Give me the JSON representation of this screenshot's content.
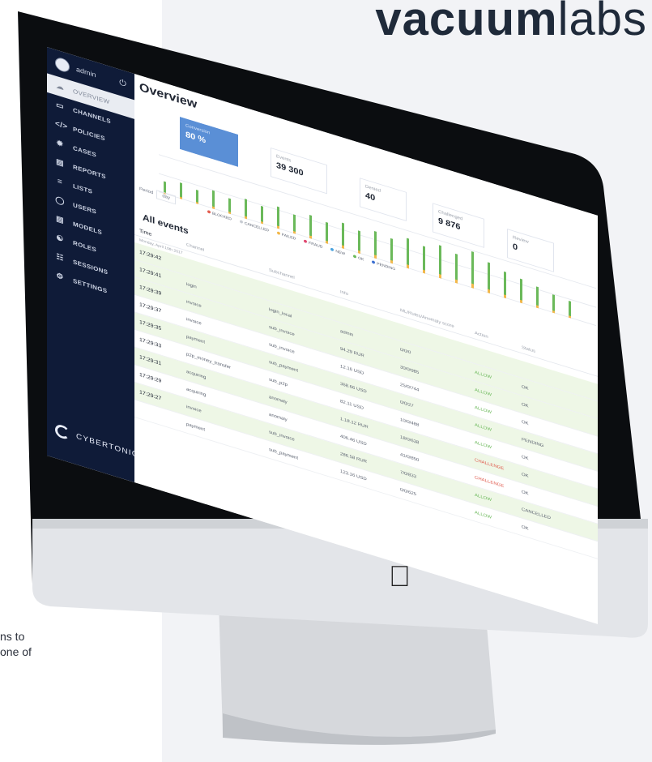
{
  "brand": {
    "name_bold": "vacuum",
    "name_light": "labs",
    "accent": "#e4115d",
    "text_color": "#1f2a3a"
  },
  "caption_fragment": [
    "ns to",
    "one of"
  ],
  "app": {
    "sidebar": {
      "user": "admin",
      "items": [
        {
          "label": "OVERVIEW",
          "icon": "cloud-icon",
          "active": true
        },
        {
          "label": "CHANNELS",
          "icon": "window-icon",
          "active": false
        },
        {
          "label": "POLICIES",
          "icon": "code-icon",
          "active": false
        },
        {
          "label": "CASES",
          "icon": "bug-icon",
          "active": false
        },
        {
          "label": "REPORTS",
          "icon": "document-icon",
          "active": false
        },
        {
          "label": "LISTS",
          "icon": "list-icon",
          "active": false
        },
        {
          "label": "USERS",
          "icon": "user-icon",
          "active": false
        },
        {
          "label": "MODELS",
          "icon": "model-icon",
          "active": false
        },
        {
          "label": "ROLES",
          "icon": "roles-icon",
          "active": false
        },
        {
          "label": "SESSIONS",
          "icon": "sessions-icon",
          "active": false
        },
        {
          "label": "SETTINGS",
          "icon": "gear-icon",
          "active": false
        }
      ],
      "logo": "CYBERTONICA"
    },
    "overview": {
      "title": "Overview",
      "kpis": {
        "conversion": {
          "label": "Conversion",
          "value": "80 %"
        },
        "events": {
          "label": "Events",
          "value": "39 300"
        },
        "denied": {
          "label": "Denied",
          "value": "40"
        },
        "challenged": {
          "label": "Challenged",
          "value": "9 876"
        },
        "review": {
          "label": "Review",
          "value": "0"
        }
      },
      "period_label": "Period",
      "period_value": "day",
      "legend": [
        "BLOCKED",
        "CANCELLED",
        "FAILED",
        "FRAUD",
        "NEW",
        "OK",
        "PENDING"
      ],
      "legend_colors": [
        "#e35d4f",
        "#c8ccd3",
        "#f2b84b",
        "#e04870",
        "#4aa3df",
        "#6bb95a",
        "#3c6fd1"
      ]
    },
    "all_events": {
      "title": "All events",
      "headers": [
        "Time",
        "Channel",
        "Subchannel",
        "Info",
        "ML/Rules/Anomaly score",
        "Action",
        "Status"
      ],
      "date_line": "Monday, April 10th 2017",
      "rows": [
        {
          "time": "17:29:42",
          "channel": "",
          "subchannel": "",
          "info": "",
          "score": "",
          "action": "",
          "status": "",
          "green": true
        },
        {
          "time": "17:29:41",
          "channel": "login",
          "subchannel": "login_local",
          "info": "admin",
          "score": "0/0/0",
          "action": "ALLOW",
          "status": "OK",
          "green": true
        },
        {
          "time": "17:29:39",
          "channel": "invoice",
          "subchannel": "sub_invoice",
          "info": "94.29 RUR",
          "score": "30/0/985",
          "action": "ALLOW",
          "status": "OK",
          "green": true
        },
        {
          "time": "17:29:37",
          "channel": "invoice",
          "subchannel": "sub_invoice",
          "info": "12.16 USD",
          "score": "25/0/744",
          "action": "ALLOW",
          "status": "OK",
          "green": false
        },
        {
          "time": "17:29:35",
          "channel": "payment",
          "subchannel": "sub_payment",
          "info": "368.66 USD",
          "score": "0/0/27",
          "action": "ALLOW",
          "status": "PENDING",
          "green": true
        },
        {
          "time": "17:29:33",
          "channel": "p2p_money_transfer",
          "subchannel": "sub_p2p",
          "info": "82.11 USD",
          "score": "10/0/488",
          "action": "ALLOW",
          "status": "OK",
          "green": false
        },
        {
          "time": "17:29:31",
          "channel": "acquiring",
          "subchannel": "anomaly",
          "info": "1.18.12 RUR",
          "score": "18/0/638",
          "action": "CHALLENGE",
          "status": "OK",
          "green": true
        },
        {
          "time": "17:29:29",
          "channel": "acquiring",
          "subchannel": "anomaly",
          "info": "406.46 USD",
          "score": "41/0/850",
          "action": "CHALLENGE",
          "status": "OK",
          "green": false
        },
        {
          "time": "17:29:27",
          "channel": "invoice",
          "subchannel": "sub_invoice",
          "info": "286.58 RUR",
          "score": "7/0/833",
          "action": "ALLOW",
          "status": "CANCELLED",
          "green": true
        },
        {
          "time": "",
          "channel": "payment",
          "subchannel": "sub_payment",
          "info": "123.16 USD",
          "score": "0/0/625",
          "action": "ALLOW",
          "status": "OK",
          "green": false
        }
      ]
    }
  }
}
